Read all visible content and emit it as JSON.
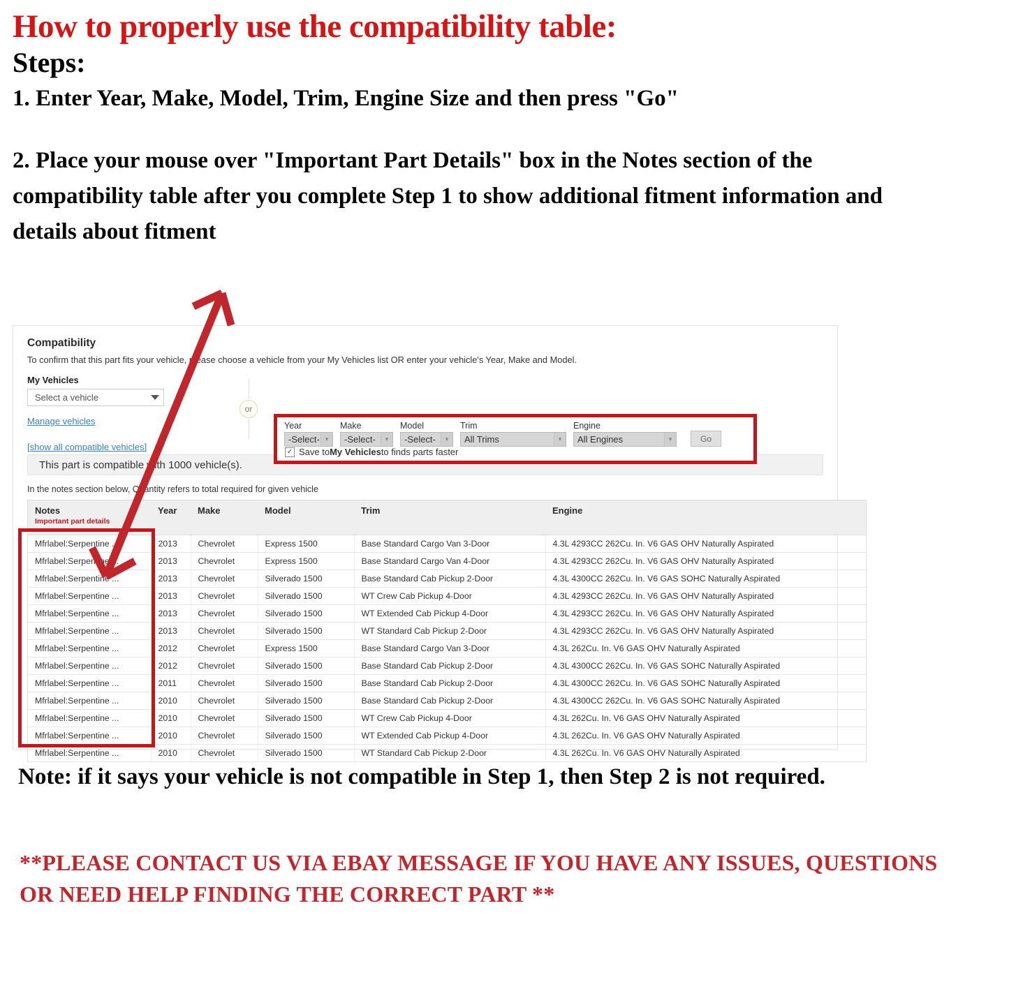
{
  "header": {
    "title": "How to properly use the compatibility table:",
    "steps_label": "Steps:",
    "step1": "1. Enter Year, Make, Model, Trim, Engine Size and then press \"Go\"",
    "step2": "2. Place your mouse over \"Important Part Details\" box in the Notes section of the compatibility table after you complete Step 1 to show additional fitment information and details about fitment"
  },
  "compatibility": {
    "title": "Compatibility",
    "subtitle": "To confirm that this part fits your vehicle, please choose a vehicle from your My Vehicles list OR enter your vehicle's Year, Make and Model.",
    "my_vehicles_label": "My Vehicles",
    "vehicle_select_value": "Select a vehicle",
    "manage_vehicles_link": "Manage vehicles",
    "show_all_link": "[show all compatible vehicles]",
    "or_label": "or",
    "selectors": [
      {
        "label": "Year",
        "value": "-Select-"
      },
      {
        "label": "Make",
        "value": "-Select-"
      },
      {
        "label": "Model",
        "value": "-Select-"
      },
      {
        "label": "Trim",
        "value": "All Trims"
      },
      {
        "label": "Engine",
        "value": "All Engines"
      }
    ],
    "go_label": "Go",
    "save_checkbox": {
      "checked": true,
      "glyph": "✓",
      "text_before": "Save to ",
      "text_bold": "My Vehicles",
      "text_after": " to finds parts faster"
    },
    "banner": "This part is compatible with 1000 vehicle(s).",
    "qty_note": "In the notes section below, Quantity refers to total required for given vehicle",
    "table": {
      "columns": [
        {
          "label": "Notes",
          "sublabel": "Important part details"
        },
        {
          "label": "Year",
          "sublabel": ""
        },
        {
          "label": "Make",
          "sublabel": ""
        },
        {
          "label": "Model",
          "sublabel": ""
        },
        {
          "label": "Trim",
          "sublabel": ""
        },
        {
          "label": "Engine",
          "sublabel": ""
        }
      ],
      "rows": [
        {
          "notes": "Mfrlabel:Serpentine ...",
          "year": "2013",
          "make": "Chevrolet",
          "model": "Express 1500",
          "trim": "Base Standard Cargo Van 3-Door",
          "engine": "4.3L 4293CC 262Cu. In. V6 GAS OHV Naturally Aspirated"
        },
        {
          "notes": "Mfrlabel:Serpentine ...",
          "year": "2013",
          "make": "Chevrolet",
          "model": "Express 1500",
          "trim": "Base Standard Cargo Van 4-Door",
          "engine": "4.3L 4293CC 262Cu. In. V6 GAS OHV Naturally Aspirated"
        },
        {
          "notes": "Mfrlabel:Serpentine ...",
          "year": "2013",
          "make": "Chevrolet",
          "model": "Silverado 1500",
          "trim": "Base Standard Cab Pickup 2-Door",
          "engine": "4.3L 4300CC 262Cu. In. V6 GAS SOHC Naturally Aspirated"
        },
        {
          "notes": "Mfrlabel:Serpentine ...",
          "year": "2013",
          "make": "Chevrolet",
          "model": "Silverado 1500",
          "trim": "WT Crew Cab Pickup 4-Door",
          "engine": "4.3L 4293CC 262Cu. In. V6 GAS OHV Naturally Aspirated"
        },
        {
          "notes": "Mfrlabel:Serpentine ...",
          "year": "2013",
          "make": "Chevrolet",
          "model": "Silverado 1500",
          "trim": "WT Extended Cab Pickup 4-Door",
          "engine": "4.3L 4293CC 262Cu. In. V6 GAS OHV Naturally Aspirated"
        },
        {
          "notes": "Mfrlabel:Serpentine ...",
          "year": "2013",
          "make": "Chevrolet",
          "model": "Silverado 1500",
          "trim": "WT Standard Cab Pickup 2-Door",
          "engine": "4.3L 4293CC 262Cu. In. V6 GAS OHV Naturally Aspirated"
        },
        {
          "notes": "Mfrlabel:Serpentine ...",
          "year": "2012",
          "make": "Chevrolet",
          "model": "Express 1500",
          "trim": "Base Standard Cargo Van 3-Door",
          "engine": "4.3L 262Cu. In. V6 GAS OHV Naturally Aspirated"
        },
        {
          "notes": "Mfrlabel:Serpentine ...",
          "year": "2012",
          "make": "Chevrolet",
          "model": "Silverado 1500",
          "trim": "Base Standard Cab Pickup 2-Door",
          "engine": "4.3L 4300CC 262Cu. In. V6 GAS SOHC Naturally Aspirated"
        },
        {
          "notes": "Mfrlabel:Serpentine ...",
          "year": "2011",
          "make": "Chevrolet",
          "model": "Silverado 1500",
          "trim": "Base Standard Cab Pickup 2-Door",
          "engine": "4.3L 4300CC 262Cu. In. V6 GAS SOHC Naturally Aspirated"
        },
        {
          "notes": "Mfrlabel:Serpentine ...",
          "year": "2010",
          "make": "Chevrolet",
          "model": "Silverado 1500",
          "trim": "Base Standard Cab Pickup 2-Door",
          "engine": "4.3L 4300CC 262Cu. In. V6 GAS SOHC Naturally Aspirated"
        },
        {
          "notes": "Mfrlabel:Serpentine ...",
          "year": "2010",
          "make": "Chevrolet",
          "model": "Silverado 1500",
          "trim": "WT Crew Cab Pickup 4-Door",
          "engine": "4.3L 262Cu. In. V6 GAS OHV Naturally Aspirated"
        },
        {
          "notes": "Mfrlabel:Serpentine ...",
          "year": "2010",
          "make": "Chevrolet",
          "model": "Silverado 1500",
          "trim": "WT Extended Cab Pickup 4-Door",
          "engine": "4.3L 262Cu. In. V6 GAS OHV Naturally Aspirated"
        },
        {
          "notes": "Mfrlabel:Serpentine ...",
          "year": "2010",
          "make": "Chevrolet",
          "model": "Silverado 1500",
          "trim": "WT Standard Cab Pickup 2-Door",
          "engine": "4.3L 262Cu. In. V6 GAS OHV Naturally Aspirated"
        }
      ]
    }
  },
  "footer": {
    "note": "Note: if it says your vehicle is not compatible in Step 1, then Step 2 is not required.",
    "contact": "**PLEASE CONTACT US VIA EBAY MESSAGE IF YOU HAVE ANY ISSUES, QUESTIONS OR NEED HELP FINDING THE CORRECT PART **"
  },
  "colors": {
    "red_heading": "#d31515",
    "red_box": "#c0191c",
    "red_contact": "#c0272d",
    "link_blue": "#3a7fb5"
  }
}
